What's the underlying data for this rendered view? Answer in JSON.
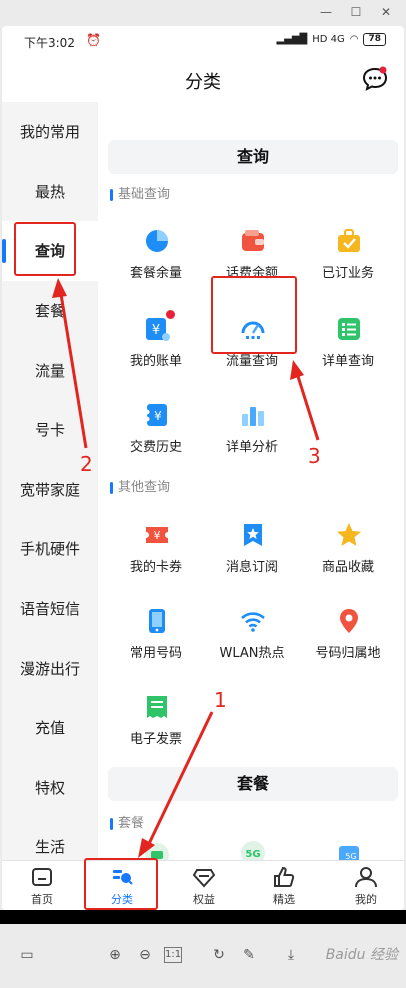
{
  "status": {
    "time": "下午3:02",
    "net": "HD 4G",
    "battery": "78"
  },
  "title": "分类",
  "sidebar": [
    {
      "label": "我的常用"
    },
    {
      "label": "最热"
    },
    {
      "label": "查询",
      "active": true
    },
    {
      "label": "套餐"
    },
    {
      "label": "流量"
    },
    {
      "label": "号卡"
    },
    {
      "label": "宽带家庭"
    },
    {
      "label": "手机硬件"
    },
    {
      "label": "语音短信"
    },
    {
      "label": "漫游出行"
    },
    {
      "label": "充值"
    },
    {
      "label": "特权"
    },
    {
      "label": "生活"
    }
  ],
  "content": {
    "query_section_title": "查询",
    "basic_query_label": "基础查询",
    "basic_items": [
      {
        "label": "套餐余量",
        "icon": "pie-chart-icon"
      },
      {
        "label": "话费余额",
        "icon": "wallet-icon"
      },
      {
        "label": "已订业务",
        "icon": "briefcase-icon"
      },
      {
        "label": "我的账单",
        "icon": "bill-icon",
        "badge": true
      },
      {
        "label": "流量查询",
        "icon": "speedometer-icon"
      },
      {
        "label": "详单查询",
        "icon": "list-icon"
      },
      {
        "label": "交费历史",
        "icon": "payment-history-icon"
      },
      {
        "label": "详单分析",
        "icon": "bar-chart-icon"
      }
    ],
    "other_query_label": "其他查询",
    "other_items": [
      {
        "label": "我的卡券",
        "icon": "coupon-icon"
      },
      {
        "label": "消息订阅",
        "icon": "bookmark-star-icon"
      },
      {
        "label": "商品收藏",
        "icon": "star-icon"
      },
      {
        "label": "常用号码",
        "icon": "phone-icon"
      },
      {
        "label": "WLAN热点",
        "icon": "wifi-icon"
      },
      {
        "label": "号码归属地",
        "icon": "location-pin-icon"
      },
      {
        "label": "电子发票",
        "icon": "invoice-icon"
      }
    ],
    "package_section_title": "套餐",
    "package_sub_label": "套餐"
  },
  "tabs": [
    {
      "label": "首页",
      "icon": "home-icon"
    },
    {
      "label": "分类",
      "icon": "category-icon",
      "active": true
    },
    {
      "label": "权益",
      "icon": "diamond-icon"
    },
    {
      "label": "精选",
      "icon": "thumbs-up-icon"
    },
    {
      "label": "我的",
      "icon": "user-icon"
    }
  ],
  "annotations": {
    "one": "1",
    "two": "2",
    "three": "3"
  },
  "watermark": "Baidu 经验",
  "colors": {
    "accent": "#1677ff",
    "annotation": "#e2261f",
    "badge": "#e8213a"
  }
}
